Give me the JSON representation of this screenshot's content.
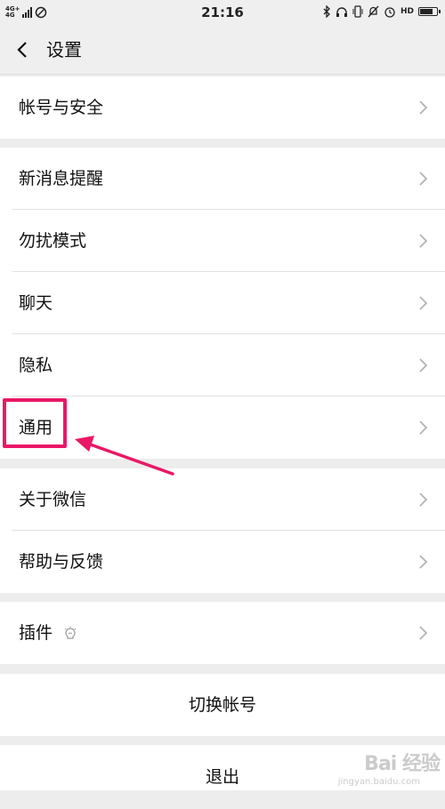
{
  "status_bar": {
    "network_top": "4G+",
    "network_bottom": "4G",
    "time": "21:16",
    "right_icons": [
      "bluetooth-icon",
      "headset-icon",
      "vibrate-icon",
      "mute-bell-icon",
      "alarm-icon"
    ],
    "hd_label": "HD",
    "battery_level": 0.85
  },
  "nav": {
    "back_icon": "chevron-left-icon",
    "title": "设置"
  },
  "menu": {
    "account_security": "帐号与安全",
    "new_message_notify": "新消息提醒",
    "do_not_disturb": "勿扰模式",
    "chat": "聊天",
    "privacy": "隐私",
    "general": "通用",
    "about_wechat": "关于微信",
    "help_feedback": "帮助与反馈",
    "plugins": "插件"
  },
  "actions": {
    "switch_account": "切换帐号",
    "logout": "退出"
  },
  "annotation": {
    "highlight_color": "#ea1866"
  },
  "watermark": {
    "brand": "Bai 经验",
    "url": "jingyan.baidu.com"
  },
  "colors": {
    "page_bg": "#ededed",
    "row_bg": "#ffffff",
    "chevron": "#b3b3b3"
  }
}
